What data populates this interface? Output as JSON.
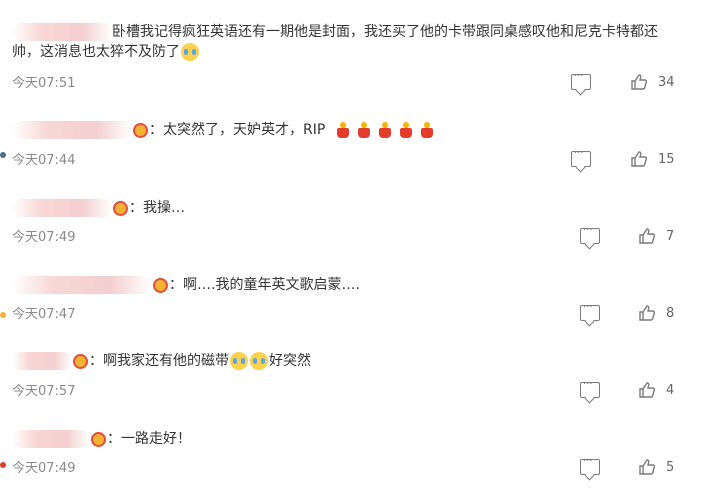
{
  "comments": [
    {
      "text": "卧槽我记得疯狂英语还有一期他是封面，我还买了他的卡带跟同桌感叹他和尼克卡特都还",
      "text2": "帅，这消息也太猝不及防了",
      "time": "今天07:51",
      "likes": "34",
      "emoji": "crying-face"
    },
    {
      "text": "：太突然了，天妒英才，RIP",
      "time": "今天07:44",
      "likes": "15",
      "candles": 5
    },
    {
      "text": "：我操…",
      "time": "今天07:49",
      "likes": "7"
    },
    {
      "text": "：啊….我的童年英文歌启蒙….",
      "time": "今天07:47",
      "likes": "8"
    },
    {
      "text_a": "：啊我家还有他的磁带",
      "text_b": "好突然",
      "time": "今天07:57",
      "likes": "4"
    },
    {
      "text": "：一路走好！",
      "time": "今天07:49",
      "likes": "5"
    }
  ],
  "icons": {
    "reply": "comment-icon",
    "like": "thumbs-up-icon",
    "candle": "candle-icon",
    "badge": "fan-badge-icon",
    "crying": "crying-face-icon"
  }
}
